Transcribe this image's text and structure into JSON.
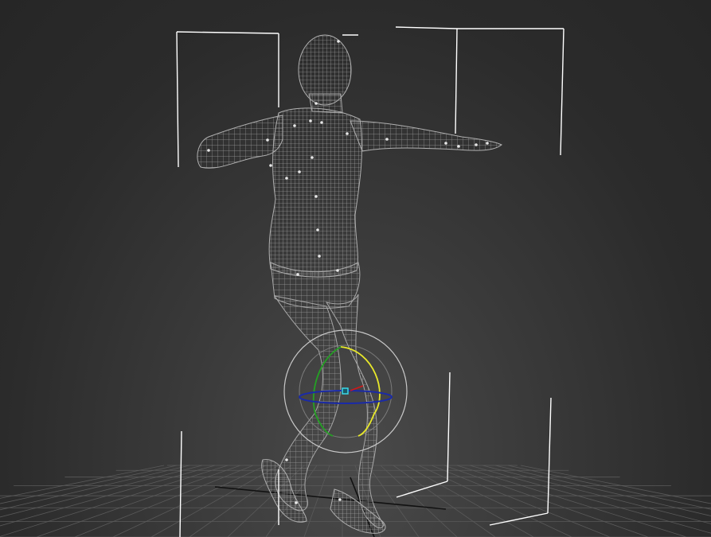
{
  "viewport": {
    "label": "",
    "shading": "wireframe"
  },
  "scene": {
    "object": "character-wireframe-mesh",
    "selection": "bounding-box-brackets",
    "gizmo": "rotate-gizmo",
    "grid": true
  },
  "colors": {
    "background_center": "#4a4a4a",
    "background_edge": "#262626",
    "mesh": "#9a9a9a",
    "mesh_dense": "#bdbdbd",
    "bounding_box": "#ffffff",
    "grid": "#5a5a5a",
    "grid_axis": "#111111",
    "gizmo_x": "#d21818",
    "gizmo_y": "#e8e82a",
    "gizmo_z": "#1a2aa8",
    "gizmo_green": "#24a024",
    "gizmo_outer": "#c8c8c8",
    "gizmo_pivot": "#39d8e8"
  }
}
